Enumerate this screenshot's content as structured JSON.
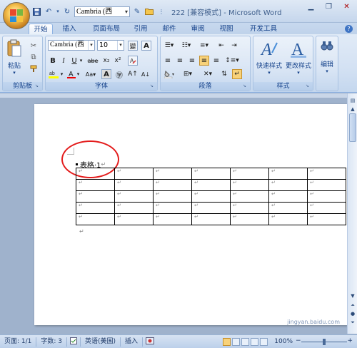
{
  "window": {
    "title": "222 [兼容模式] - Microsoft Word",
    "qat_font": "Cambria (西",
    "controls": [
      "minimize",
      "restore",
      "close"
    ]
  },
  "tabs": [
    "开始",
    "插入",
    "页面布局",
    "引用",
    "邮件",
    "审阅",
    "视图",
    "开发工具"
  ],
  "active_tab": "开始",
  "ribbon": {
    "clipboard": {
      "paste_label": "粘贴",
      "group_label": "剪贴板"
    },
    "font": {
      "font_name": "Cambria (西",
      "font_size": "10",
      "wen_label": "變",
      "a_label": "A",
      "bold": "B",
      "italic": "I",
      "underline": "U",
      "strike": "abe",
      "sub": "x₂",
      "sup": "x²",
      "group_label": "字体"
    },
    "paragraph": {
      "group_label": "段落"
    },
    "styles": {
      "quick_styles": "快速样式",
      "change_styles": "更改样式",
      "group_label": "样式"
    },
    "editing": {
      "label": "编辑"
    }
  },
  "document": {
    "caption": "表格·1",
    "para_mark": "↵",
    "table": {
      "rows": [
        [
          "↵",
          "↵",
          "↵",
          "↵",
          "↵",
          "↵",
          "↵"
        ],
        [
          "↵",
          "↵",
          "↵",
          "↵",
          "↵",
          "↵",
          "↵"
        ],
        [
          "↵",
          "↵",
          "↵",
          "↵",
          "↵",
          "↵",
          "↵"
        ],
        [
          "↵",
          "↵",
          "↵",
          "↵",
          "↵",
          "↵",
          "↵"
        ],
        [
          "↵",
          "↵",
          "↵",
          "↵",
          "↵",
          "↵",
          "↵"
        ]
      ]
    }
  },
  "statusbar": {
    "page": "页面: 1/1",
    "words": "字数: 3",
    "language": "英语(美国)",
    "mode": "插入",
    "zoom": "100%",
    "zoom_fraction": 0.5
  },
  "watermark": "jingyan.baidu.com",
  "colors": {
    "accent": "#15428b",
    "highlight_ellipse": "#e31b1b",
    "ribbon_bg": "#d3e1f3"
  }
}
